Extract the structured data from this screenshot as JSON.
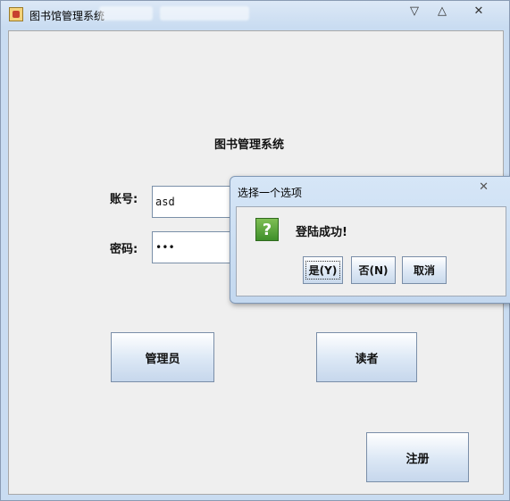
{
  "window": {
    "title": "图书馆管理系统",
    "controls": [
      "▽",
      "△",
      "✕"
    ]
  },
  "form": {
    "heading": "图书管理系统",
    "account_label": "账号:",
    "account_value": "asd",
    "password_label": "密码:",
    "password_value": "•••"
  },
  "buttons": {
    "admin": "管理员",
    "reader": "读者",
    "register": "注册"
  },
  "dialog": {
    "title": "选择一个选项",
    "close": "✕",
    "icon": "?",
    "message": "登陆成功!",
    "yes": "是(Y)",
    "no": "否(N)",
    "cancel": "取消"
  },
  "icons": {
    "app": "java-cup-icon",
    "question": "question-icon"
  },
  "colors": {
    "question_icon": "#4c9a31",
    "button_gradient_bottom": "#c6d7ec"
  }
}
